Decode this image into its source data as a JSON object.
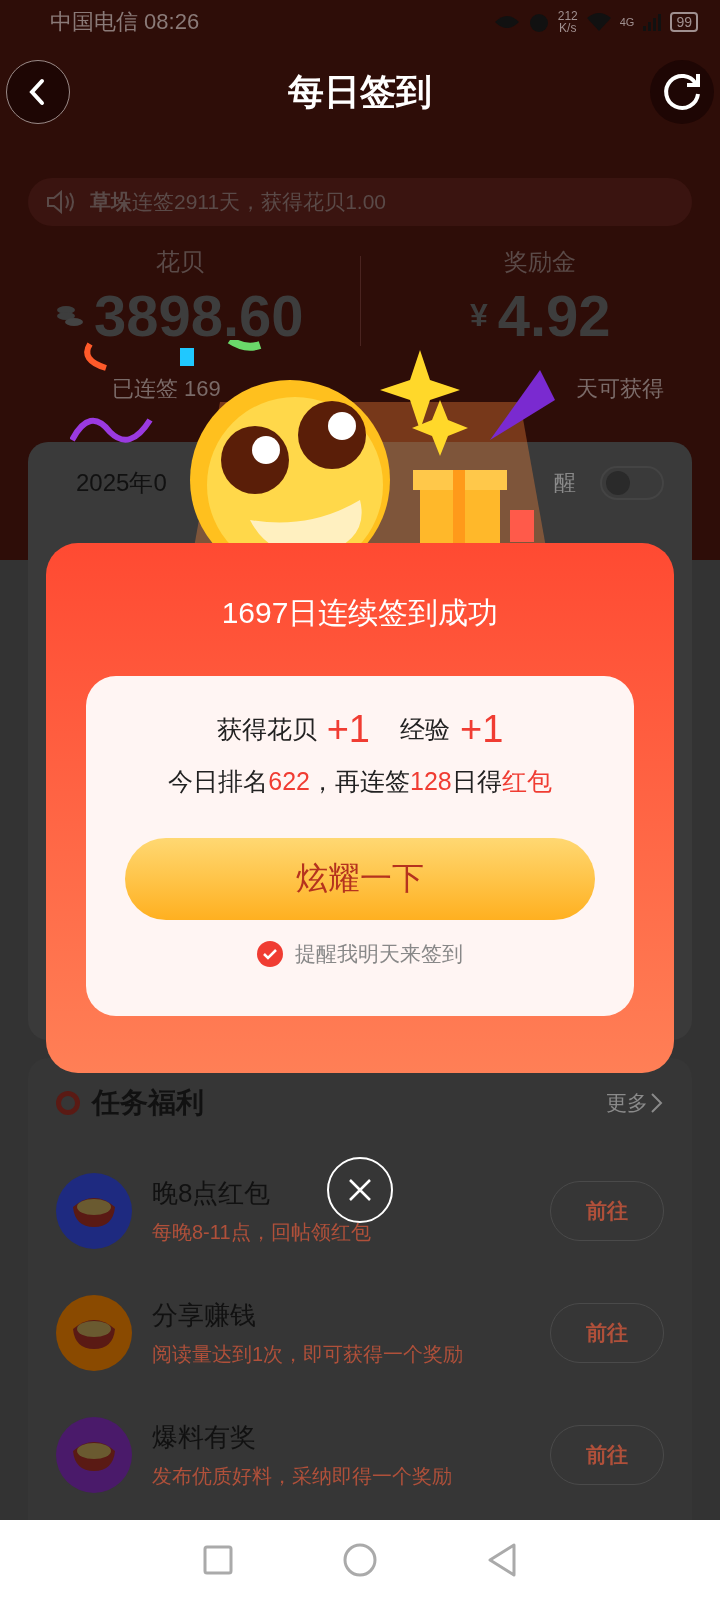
{
  "status_bar": {
    "carrier_time": "中国电信 08:26",
    "speed_value": "212",
    "speed_unit": "K/s",
    "network": "4G",
    "battery": "99"
  },
  "header": {
    "title": "每日签到"
  },
  "ticker": {
    "text": "**草垛**连签2911天，获得花贝1.00"
  },
  "stats": [
    {
      "label": "花贝",
      "value": "3898.60",
      "kind": "coins"
    },
    {
      "label": "奖励金",
      "value": "4.92",
      "prefix": "¥",
      "kind": "money"
    }
  ],
  "streak_line": {
    "left": "已连签 169",
    "right": "天可获得"
  },
  "calendar": {
    "month": "2025年0",
    "reminder_label": "醒",
    "reminder_on": false
  },
  "popup": {
    "title": "1697日连续签到成功",
    "rewards": [
      {
        "label": "获得花贝",
        "value": "+1"
      },
      {
        "label": "经验",
        "value": "+1"
      }
    ],
    "rank_segments": [
      {
        "text": "今日排名",
        "highlight": false
      },
      {
        "text": "622",
        "highlight": true
      },
      {
        "text": "，再连签",
        "highlight": false
      },
      {
        "text": "128",
        "highlight": true
      },
      {
        "text": "日得",
        "highlight": false
      },
      {
        "text": "红包",
        "highlight": true
      }
    ],
    "button": "炫耀一下",
    "remind": {
      "label": "提醒我明天来签到",
      "checked": true
    }
  },
  "tasks": {
    "title": "任务福利",
    "more": "更多",
    "items": [
      {
        "title": "晚8点红包",
        "subtitle": "每晚8-11点，回帖领红包",
        "action": "前往",
        "color": "#1e2a80"
      },
      {
        "title": "分享赚钱",
        "subtitle": "阅读量达到1次，即可获得一个奖励",
        "action": "前往",
        "color": "#8a4a00"
      },
      {
        "title": "爆料有奖",
        "subtitle": "发布优质好料，采纳即得一个奖励",
        "action": "前往",
        "color": "#4a1a6a"
      }
    ]
  }
}
